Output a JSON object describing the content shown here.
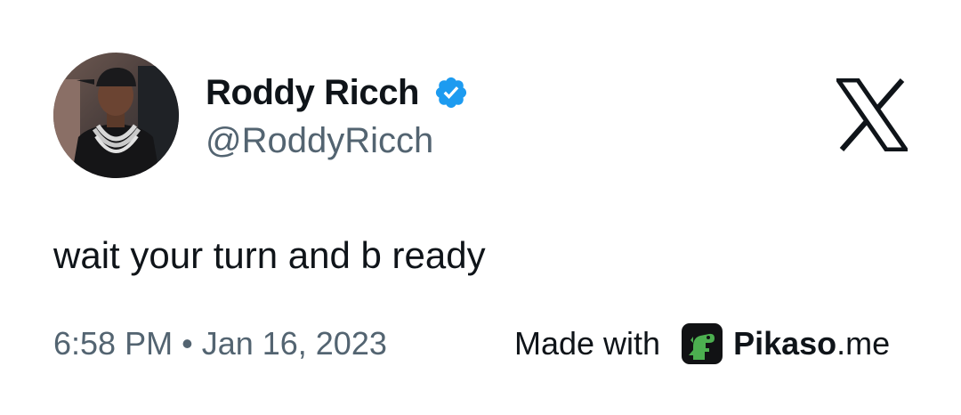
{
  "tweet": {
    "author": {
      "display_name": "Roddy Ricch",
      "handle": "@RoddyRicch",
      "verified": true
    },
    "text": "wait your turn and b ready",
    "time": "6:58 PM",
    "separator": "•",
    "date": "Jan 16, 2023"
  },
  "platform_logo": "x-logo-icon",
  "footer": {
    "made_with": "Made with",
    "brand_bold": "Pikaso",
    "brand_suffix": ".me",
    "brand_icon": "pikaso-dino-icon"
  },
  "colors": {
    "text_primary": "#0f1419",
    "text_secondary": "#536471",
    "verified_blue": "#1d9bf0",
    "pikaso_green": "#4caf50"
  }
}
